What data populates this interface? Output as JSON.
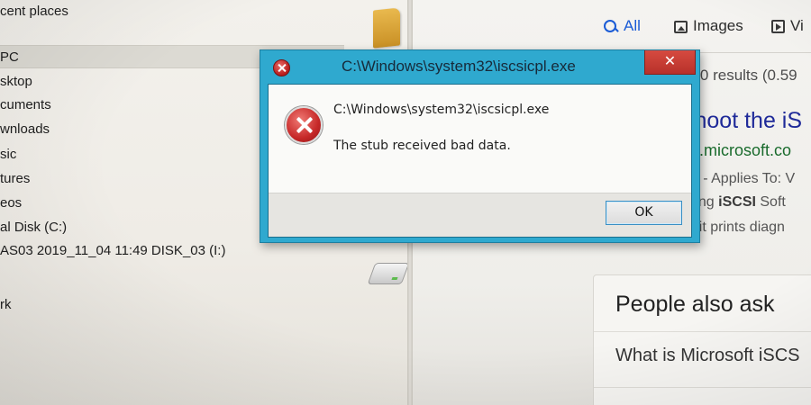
{
  "explorer": {
    "header": "cent places",
    "items": [
      {
        "label": "PC",
        "selected": true
      },
      {
        "label": "sktop"
      },
      {
        "label": "cuments"
      },
      {
        "label": "wnloads"
      },
      {
        "label": "sic"
      },
      {
        "label": "tures"
      },
      {
        "label": "eos"
      },
      {
        "label": "al Disk (C:)"
      },
      {
        "label": "AS03 2019_11_04 11:49 DISK_03 (I:)"
      },
      {
        "label": ""
      },
      {
        "label": "rk"
      }
    ]
  },
  "browser": {
    "tabs": [
      {
        "label": "All",
        "icon": "search-icon",
        "active": true
      },
      {
        "label": "Images",
        "icon": "image-icon"
      },
      {
        "label": "Vi",
        "icon": "video-icon"
      }
    ],
    "result_count": "000 results (0.59",
    "result_title": "shoot the iS",
    "result_url": "cs.microsoft.co",
    "result_meta": "16 - Applies To: V",
    "snippet1_prefix": "oting ",
    "snippet1_bold": "iSCSI",
    "snippet1_suffix": " Soft",
    "snippet2": "ut it prints diagn",
    "people_also_ask": {
      "title": "People also ask",
      "question": "What is Microsoft iSCS"
    }
  },
  "dialog": {
    "title": "C:\\Windows\\system32\\iscsicpl.exe",
    "close_label": "✕",
    "message_path": "C:\\Windows\\system32\\iscsicpl.exe",
    "message": "The stub received bad data.",
    "ok_label": "OK",
    "accent_color": "#2fa9cf",
    "close_color": "#c9362e"
  }
}
